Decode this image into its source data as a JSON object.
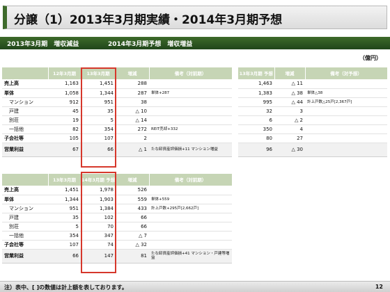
{
  "title": "分譲（1）2013年3月期実績・2014年3月期予想",
  "section_left": "2013年3月期　増収減益",
  "section_right": "2014年3月期予想　増収増益",
  "unit": "（億円）",
  "table1": {
    "headers": [
      "",
      "12年3月期",
      "13年3月期",
      "増減",
      "備考（対前期）"
    ],
    "rows": [
      {
        "label": "売上高",
        "a": "1,163",
        "b": "1,451",
        "diff": "288",
        "note": ""
      },
      {
        "label": "単体",
        "a": "1,058",
        "b": "1,344",
        "diff": "287",
        "note": "単体+287"
      },
      {
        "label": "マンション",
        "a": "912",
        "b": "951",
        "diff": "38",
        "note": ""
      },
      {
        "label": "戸建",
        "a": "45",
        "b": "35",
        "diff": "△ 10",
        "note": ""
      },
      {
        "label": "別荘",
        "a": "19",
        "b": "5",
        "diff": "△ 14",
        "note": ""
      },
      {
        "label": "一括他",
        "a": "82",
        "b": "354",
        "diff": "272",
        "note": "REIT売却+332"
      },
      {
        "label": "子会社等",
        "a": "105",
        "b": "107",
        "diff": "2",
        "note": ""
      },
      {
        "label": "営業利益",
        "a": "67",
        "b": "66",
        "diff": "△ 1",
        "note": "たな卸資産評価損+11 マンション増益"
      }
    ]
  },
  "table2": {
    "headers": [
      "",
      "13年3月期",
      "14年3月期 予想",
      "増減",
      "備考（対前期）"
    ],
    "rows": [
      {
        "label": "売上高",
        "a": "1,451",
        "b": "1,978",
        "diff": "526",
        "note": ""
      },
      {
        "label": "単体",
        "a": "1,344",
        "b": "1,903",
        "diff": "559",
        "note": "単体+559"
      },
      {
        "label": "マンション",
        "a": "951",
        "b": "1,384",
        "diff": "433",
        "note": "計上戸数+295戸[2,662戸]"
      },
      {
        "label": "戸建",
        "a": "35",
        "b": "102",
        "diff": "66",
        "note": ""
      },
      {
        "label": "別荘",
        "a": "5",
        "b": "70",
        "diff": "66",
        "note": ""
      },
      {
        "label": "一括他",
        "a": "354",
        "b": "347",
        "diff": "△ 7",
        "note": ""
      },
      {
        "label": "子会社等",
        "a": "107",
        "b": "74",
        "diff": "△ 32",
        "note": ""
      },
      {
        "label": "営業利益",
        "a": "66",
        "b": "147",
        "diff": "81",
        "note": "たな卸資産評価損+41 マンション・戸建等増益"
      }
    ]
  },
  "table3": {
    "headers": [
      "13年3月期 予想",
      "増減",
      "備考（対予想）"
    ],
    "rows": [
      {
        "a": "1,463",
        "diff": "△ 11",
        "note": ""
      },
      {
        "a": "1,383",
        "diff": "△ 38",
        "note": "単体△38"
      },
      {
        "a": "995",
        "diff": "△ 44",
        "note": "計上戸数△25戸[2,367戸]"
      },
      {
        "a": "32",
        "diff": "3",
        "note": ""
      },
      {
        "a": "6",
        "diff": "△ 2",
        "note": ""
      },
      {
        "a": "350",
        "diff": "4",
        "note": ""
      },
      {
        "a": "80",
        "diff": "27",
        "note": ""
      },
      {
        "a": "96",
        "diff": "△ 30",
        "note": ""
      }
    ]
  },
  "footnote": "注）表中、[ ]の数値は計上額を表しております。",
  "page_number": "12"
}
